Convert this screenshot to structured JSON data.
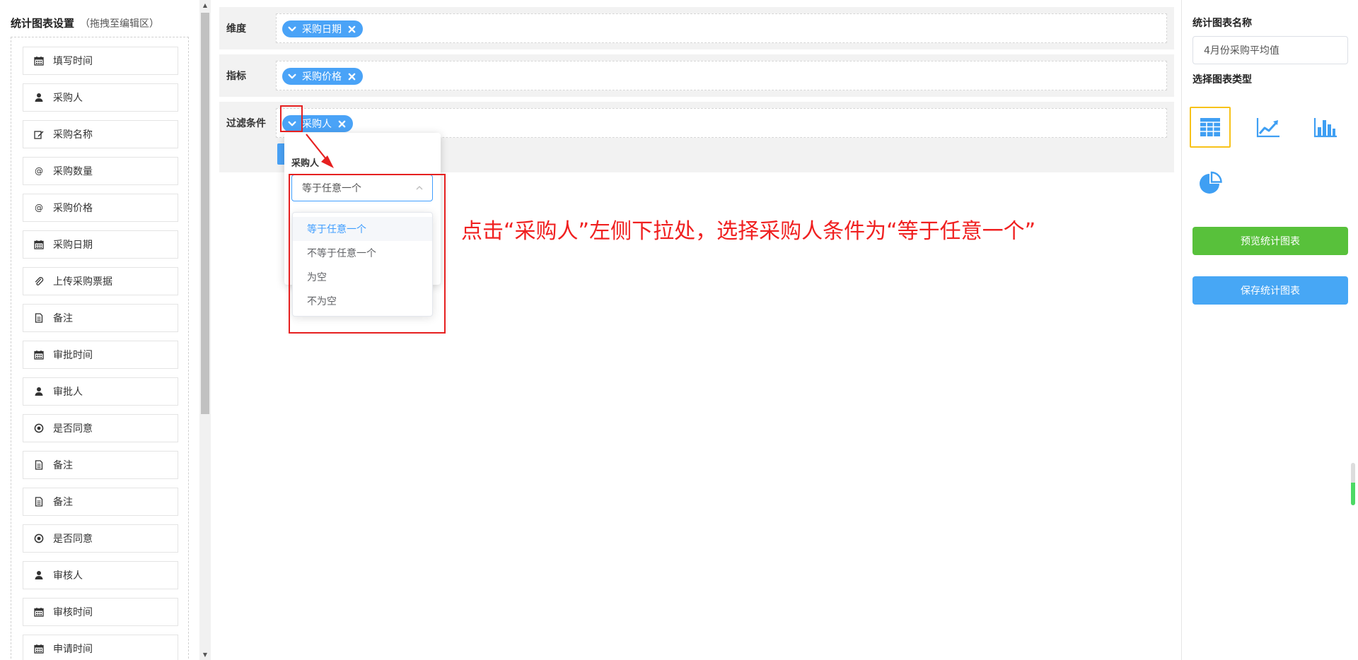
{
  "left_panel": {
    "title": "统计图表设置",
    "hint": "（拖拽至编辑区）",
    "fields": [
      {
        "label": "填写时间",
        "icon": "calendar-icon"
      },
      {
        "label": "采购人",
        "icon": "user-icon"
      },
      {
        "label": "采购名称",
        "icon": "edit-icon"
      },
      {
        "label": "采购数量",
        "icon": "at-icon"
      },
      {
        "label": "采购价格",
        "icon": "at-icon"
      },
      {
        "label": "采购日期",
        "icon": "calendar-icon"
      },
      {
        "label": "上传采购票据",
        "icon": "paperclip-icon"
      },
      {
        "label": "备注",
        "icon": "document-icon"
      },
      {
        "label": "审批时间",
        "icon": "calendar-icon"
      },
      {
        "label": "审批人",
        "icon": "user-icon"
      },
      {
        "label": "是否同意",
        "icon": "radio-icon"
      },
      {
        "label": "备注",
        "icon": "document-icon"
      },
      {
        "label": "备注",
        "icon": "document-icon"
      },
      {
        "label": "是否同意",
        "icon": "radio-icon"
      },
      {
        "label": "审核人",
        "icon": "user-icon"
      },
      {
        "label": "审核时间",
        "icon": "calendar-icon"
      },
      {
        "label": "申请时间",
        "icon": "calendar-icon"
      }
    ]
  },
  "config": {
    "dimension": {
      "label": "维度",
      "chip": "采购日期"
    },
    "metric": {
      "label": "指标",
      "chip": "采购价格"
    },
    "filter": {
      "label": "过滤条件",
      "chip": "采购人"
    }
  },
  "popover": {
    "title": "采购人",
    "select_value": "等于任意一个",
    "options": [
      "等于任意一个",
      "不等于任意一个",
      "为空",
      "不为空"
    ],
    "selected_index": 0
  },
  "annotation": {
    "text": "点击“采购人”左侧下拉处，选择采购人条件为“等于任意一个”",
    "color": "#f02020"
  },
  "right_panel": {
    "name_label": "统计图表名称",
    "name_value": "4月份采购平均值",
    "type_label": "选择图表类型",
    "types": [
      "table-chart-icon",
      "line-chart-icon",
      "bar-chart-icon",
      "pie-chart-icon"
    ],
    "active_type": "table-chart-icon",
    "preview_button": "预览统计图表",
    "save_button": "保存统计图表",
    "colors": {
      "accent": "#4aa3f7",
      "preview": "#58c13b",
      "save": "#47a7f5",
      "active_border": "#f7c21a"
    }
  }
}
